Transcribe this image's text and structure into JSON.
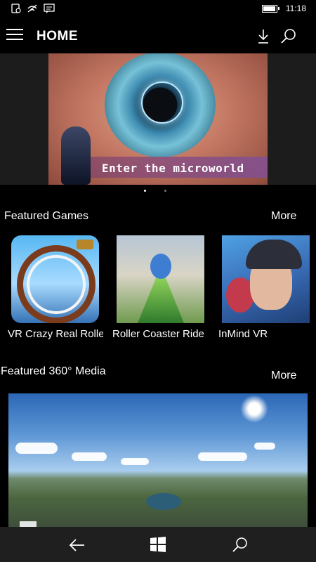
{
  "status_bar": {
    "time": "11:18",
    "icons": [
      "notification-icon",
      "wifi-icon",
      "message-icon",
      "battery-icon"
    ],
    "battery_level": 0.85
  },
  "header": {
    "title": "HOME",
    "icons": [
      "hamburger-menu-icon",
      "download-icon",
      "search-icon"
    ]
  },
  "hero": {
    "caption": "Enter the microworld",
    "slides_total": 2,
    "active_slide": 1
  },
  "featured_games": {
    "title": "Featured Games",
    "more_label": "More",
    "items": [
      {
        "label": "VR Crazy Real Roller"
      },
      {
        "label": "Roller Coaster Ride"
      },
      {
        "label": "InMind VR"
      }
    ]
  },
  "featured_media": {
    "title": "Featured 360° Media",
    "more_label": "More"
  },
  "nav_bar": {
    "icons": [
      "back-arrow-icon",
      "windows-start-icon",
      "search-icon"
    ]
  },
  "colors": {
    "background": "#000000",
    "nav_bar": "#1f1f1f",
    "hero_band": "#1c1c1c"
  }
}
